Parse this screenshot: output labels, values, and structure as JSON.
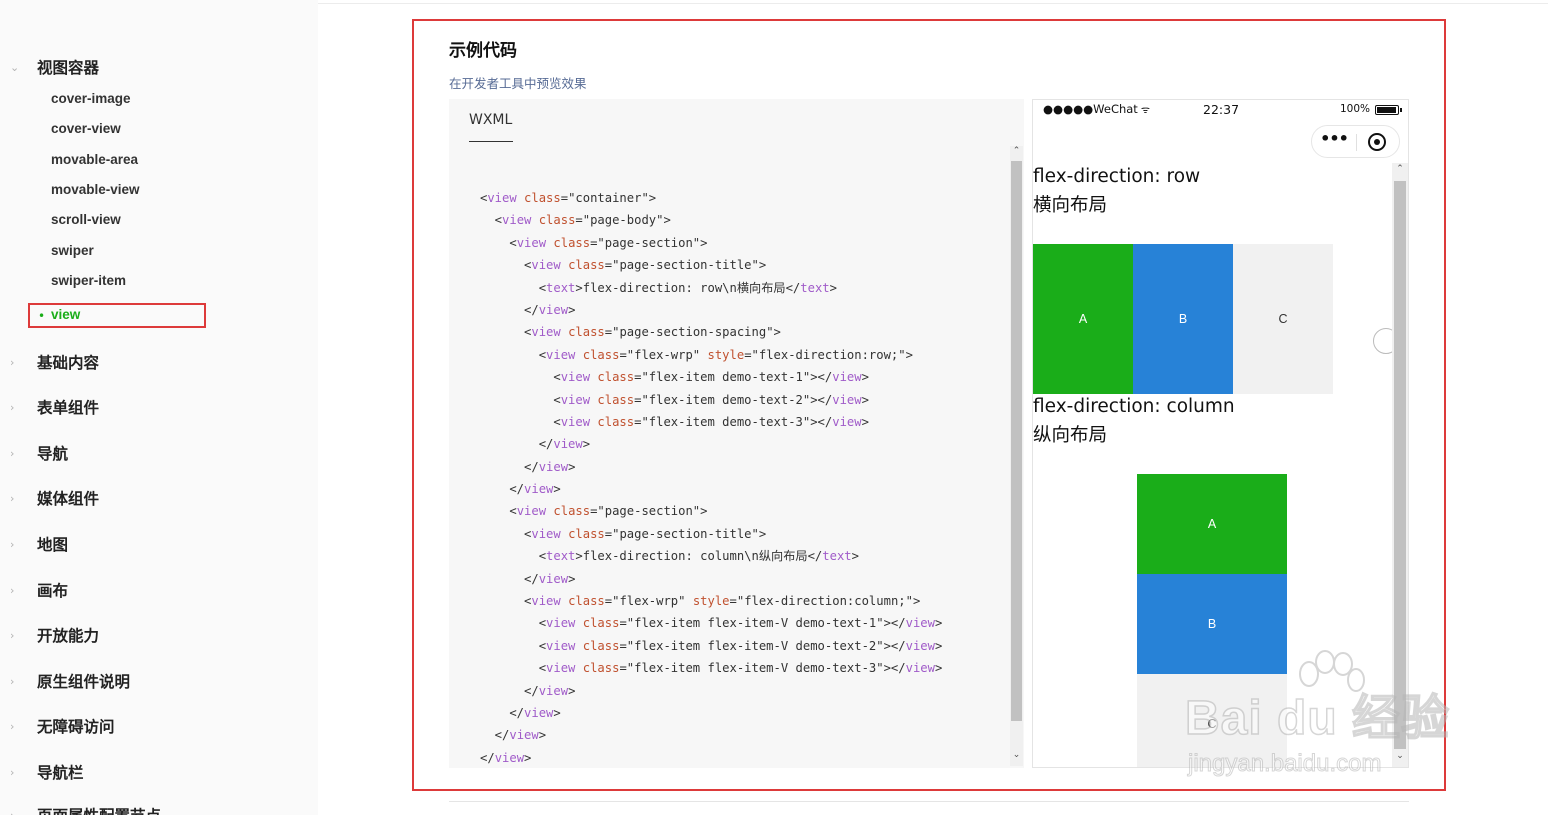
{
  "sidebar": {
    "groups": [
      {
        "label": "视图容器",
        "caret": "⌄"
      },
      {
        "label": "基础内容",
        "caret": "›"
      },
      {
        "label": "表单组件",
        "caret": "›"
      },
      {
        "label": "导航",
        "caret": "›"
      },
      {
        "label": "媒体组件",
        "caret": "›"
      },
      {
        "label": "地图",
        "caret": "›"
      },
      {
        "label": "画布",
        "caret": "›"
      },
      {
        "label": "开放能力",
        "caret": "›"
      },
      {
        "label": "原生组件说明",
        "caret": "›"
      },
      {
        "label": "无障碍访问",
        "caret": "›"
      },
      {
        "label": "导航栏",
        "caret": "›"
      },
      {
        "label": "页面属性配置节点",
        "caret": "›"
      }
    ],
    "sub_items": [
      "cover-image",
      "cover-view",
      "movable-area",
      "movable-view",
      "scroll-view",
      "swiper",
      "swiper-item"
    ],
    "active_item": {
      "label": "view",
      "bullet": "•"
    }
  },
  "main": {
    "section_title": "示例代码",
    "preview_link": "在开发者工具中预览效果",
    "code_tab": "WXML",
    "code_lines": [
      "<view class=\"container\">",
      "  <view class=\"page-body\">",
      "    <view class=\"page-section\">",
      "      <view class=\"page-section-title\">",
      "        <text>flex-direction: row\\n横向布局</text>",
      "      </view>",
      "      <view class=\"page-section-spacing\">",
      "        <view class=\"flex-wrp\" style=\"flex-direction:row;\">",
      "          <view class=\"flex-item demo-text-1\"></view>",
      "          <view class=\"flex-item demo-text-2\"></view>",
      "          <view class=\"flex-item demo-text-3\"></view>",
      "        </view>",
      "      </view>",
      "    </view>",
      "    <view class=\"page-section\">",
      "      <view class=\"page-section-title\">",
      "        <text>flex-direction: column\\n纵向布局</text>",
      "      </view>",
      "      <view class=\"flex-wrp\" style=\"flex-direction:column;\">",
      "        <view class=\"flex-item flex-item-V demo-text-1\"></view>",
      "        <view class=\"flex-item flex-item-V demo-text-2\"></view>",
      "        <view class=\"flex-item flex-item-V demo-text-3\"></view>",
      "      </view>",
      "    </view>",
      "  </view>",
      "</view>"
    ]
  },
  "phone": {
    "carrier": "●●●●●WeChat",
    "wifi_icon": "wifi-icon",
    "time": "22:37",
    "battery_pct": "100%",
    "capsule_more": "•••",
    "row_title": "flex-direction: row",
    "row_subtitle": "横向布局",
    "row_items": [
      "A",
      "B",
      "C"
    ],
    "col_title": "flex-direction: column",
    "col_subtitle": "纵向布局",
    "col_items": [
      "A",
      "B",
      "C"
    ],
    "scroll_up": "⌃",
    "scroll_down": "⌄"
  },
  "watermark": {
    "main": "Bai du 经验",
    "sub": "jingyan.baidu.com"
  },
  "colors": {
    "accent_green": "#1aad19",
    "blue": "#2782d7",
    "highlight_red": "#dd3a3a",
    "tag_purple": "#a05bc9",
    "attr_orange": "#c0512f"
  }
}
